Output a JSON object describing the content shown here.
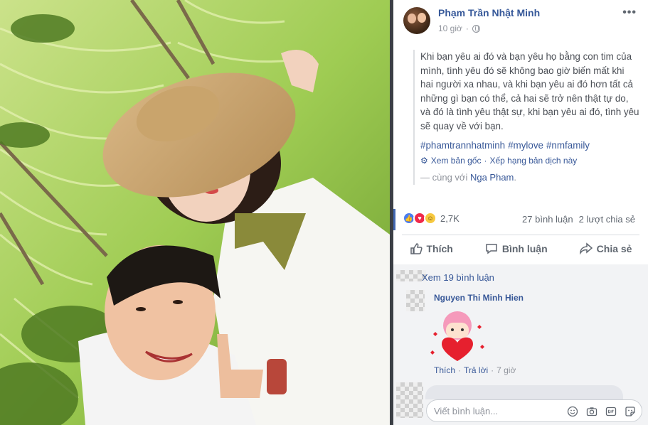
{
  "post": {
    "author": "Phạm Trần Nhật Minh",
    "time": "10 giờ",
    "more": "•••",
    "text": "Khi bạn yêu ai đó và bạn yêu họ bằng con tim của mình, tình yêu đó sẽ không bao giờ biến mất khi hai người xa nhau, và khi bạn yêu ai đó hơn tất cả những gì bạn có thể, cả hai sẽ trở nên thật tự do, và đó là tình yêu thật sự, khi bạn yêu ai đó, tình yêu sẽ quay về với bạn.",
    "hashtags": [
      "#phamtrannhatminh",
      "#mylove",
      "#nmfamily"
    ],
    "translate": {
      "see_original": "Xem bản gốc",
      "separator": "·",
      "rate": "Xếp hạng bản dịch này"
    },
    "with_prefix": "— cùng với",
    "with_person": "Nga Pham",
    "with_suffix": "."
  },
  "stats": {
    "reactions": "2,7K",
    "comments": "27 bình luận",
    "shares": "2 lượt chia sẻ"
  },
  "actions": {
    "like": "Thích",
    "comment": "Bình luận",
    "share": "Chia sẻ"
  },
  "comments": {
    "view_more": "Xem 19 bình luận",
    "first": {
      "name": "Nguyen Thi Minh Hien",
      "like": "Thích",
      "dot1": "·",
      "reply": "Trả lời",
      "dot2": "·",
      "time": "7 giờ"
    },
    "input_placeholder": "Viết bình luận..."
  },
  "colors": {
    "link": "#385898",
    "name": "#365899",
    "accent": "#4267b2"
  }
}
